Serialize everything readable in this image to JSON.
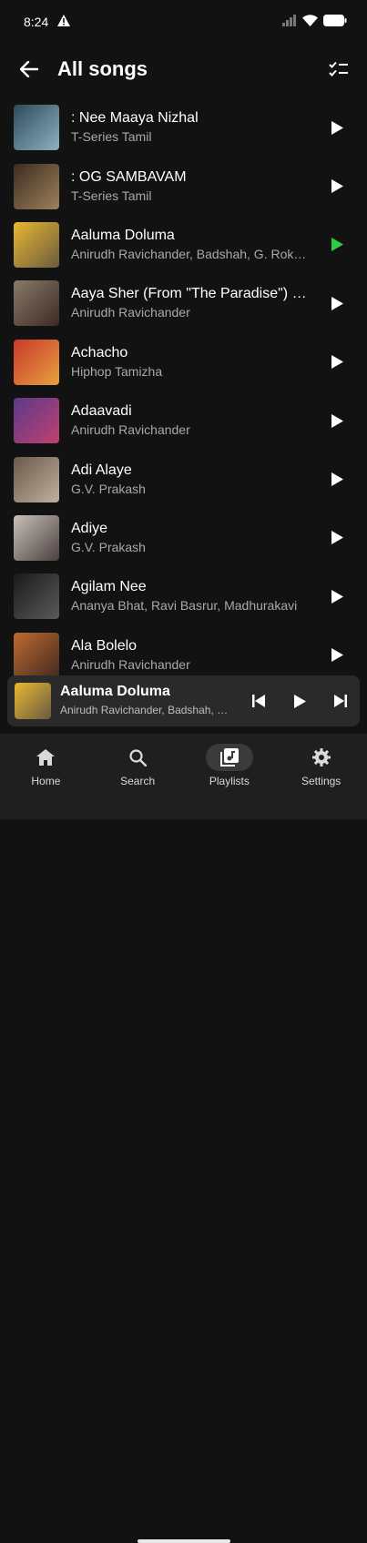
{
  "status": {
    "time": "8:24"
  },
  "header": {
    "title": "All songs"
  },
  "songs": [
    {
      "title": ": Nee Maaya Nizhal",
      "artist": "T-Series Tamil",
      "art": [
        "#2c4a5a",
        "#8fb0c0"
      ],
      "active": false
    },
    {
      "title": ": OG SAMBAVAM",
      "artist": "T-Series Tamil",
      "art": [
        "#3a2c22",
        "#a0805a"
      ],
      "active": false
    },
    {
      "title": "Aaluma Doluma",
      "artist": "Anirudh Ravichander, Badshah, G. Rokesh",
      "art": [
        "#e8b830",
        "#6a5a40"
      ],
      "active": true
    },
    {
      "title": "Aaya Sher (From \"The Paradise\") (Telugu)",
      "artist": "Anirudh Ravichander",
      "art": [
        "#8a7a6a",
        "#3a2a22"
      ],
      "active": false
    },
    {
      "title": "Achacho",
      "artist": "Hiphop Tamizha",
      "art": [
        "#c83a2a",
        "#e8a040"
      ],
      "active": false
    },
    {
      "title": "Adaavadi",
      "artist": "Anirudh Ravichander",
      "art": [
        "#5a3a8a",
        "#c04070"
      ],
      "active": false
    },
    {
      "title": "Adi Alaye",
      "artist": "G.V. Prakash",
      "art": [
        "#6a5a4a",
        "#c0b0a0"
      ],
      "active": false
    },
    {
      "title": "Adiye",
      "artist": "G.V. Prakash",
      "art": [
        "#c8c0b8",
        "#4a4040"
      ],
      "active": false
    },
    {
      "title": "Agilam Nee",
      "artist": "Ananya Bhat, Ravi Basrur, Madhurakavi",
      "art": [
        "#1a1a1a",
        "#5a5a5a"
      ],
      "active": false
    },
    {
      "title": "Ala Bolelo",
      "artist": "Anirudh Ravichander",
      "art": [
        "#c06a30",
        "#402a20"
      ],
      "active": false
    }
  ],
  "mini_player": {
    "title": "Aaluma Doluma",
    "artist": "Anirudh Ravichander, Badshah, G. Rokesh",
    "art": [
      "#e8b830",
      "#6a5a40"
    ]
  },
  "nav": [
    {
      "label": "Home",
      "icon": "home-icon",
      "active": false
    },
    {
      "label": "Search",
      "icon": "search-icon",
      "active": false
    },
    {
      "label": "Playlists",
      "icon": "playlist-icon",
      "active": true
    },
    {
      "label": "Settings",
      "icon": "gear-icon",
      "active": false
    }
  ],
  "colors": {
    "accent": "#2ecc40",
    "background": "#121212"
  }
}
